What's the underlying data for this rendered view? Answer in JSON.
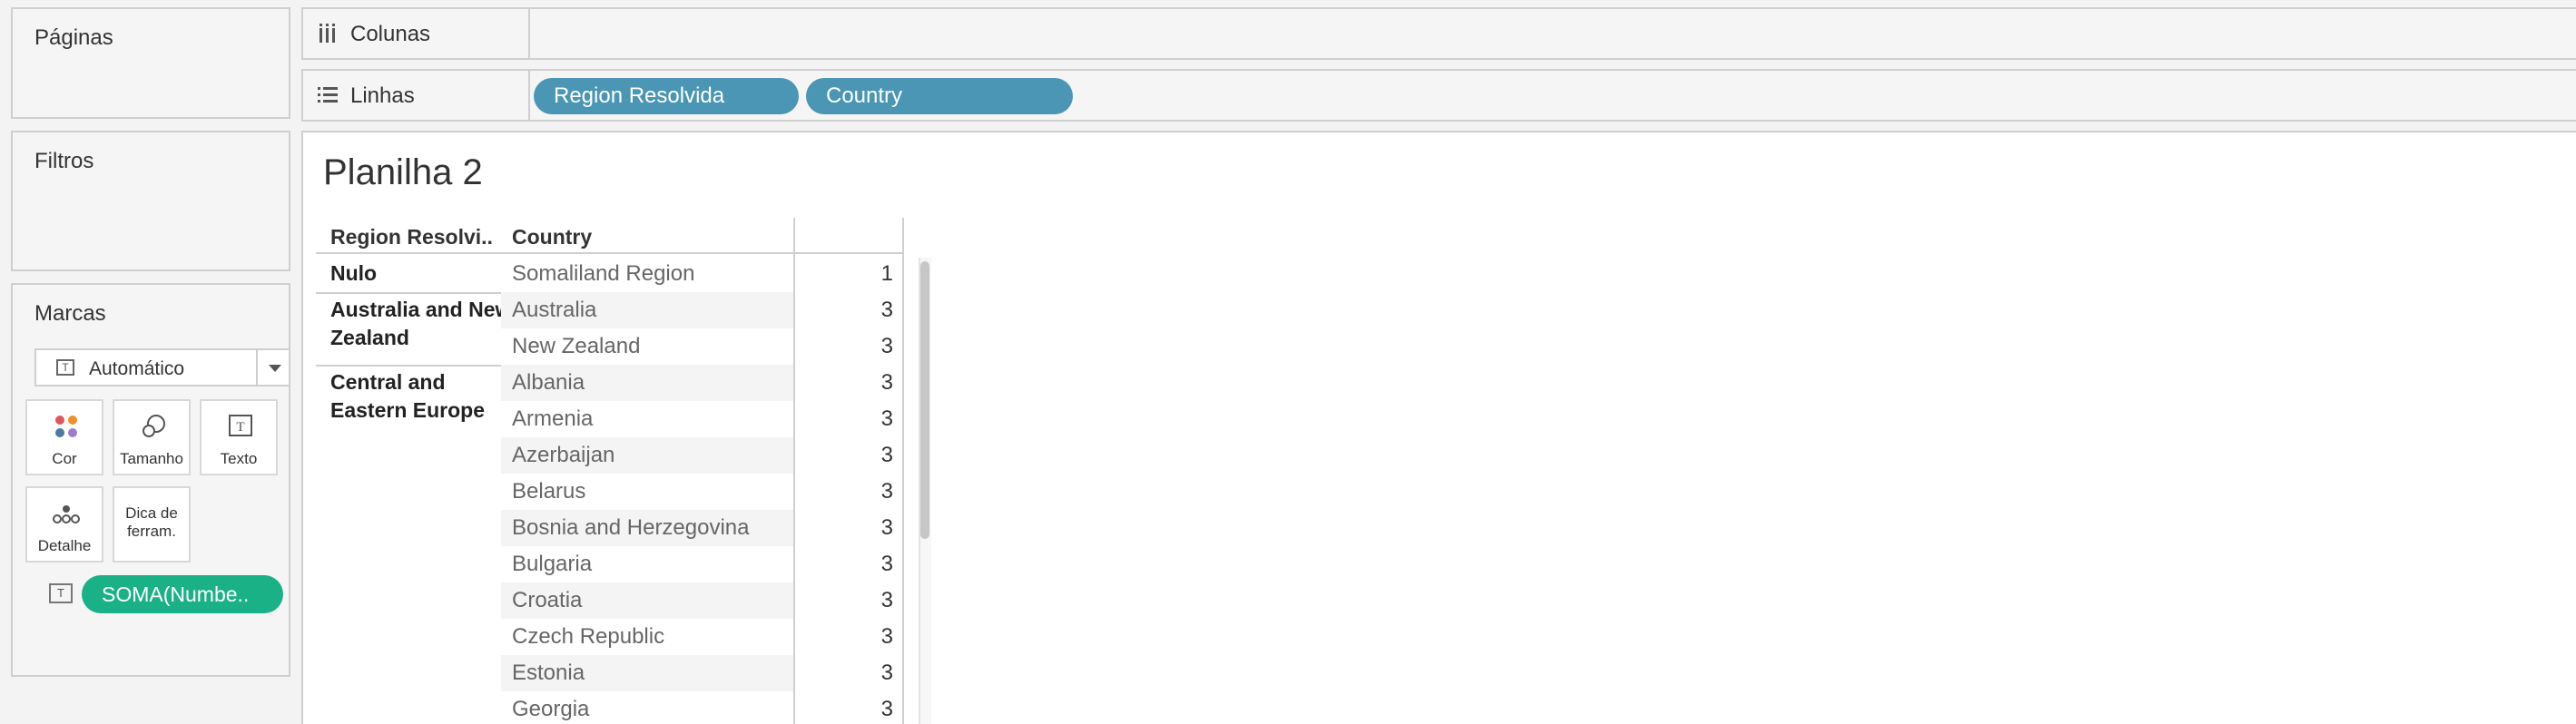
{
  "left_panels": {
    "pages_title": "Páginas",
    "filters_title": "Filtros",
    "marks_title": "Marcas"
  },
  "marks": {
    "type_label": "Automático",
    "buttons": {
      "color": "Cor",
      "size": "Tamanho",
      "text": "Texto",
      "detail": "Detalhe",
      "tooltip": "Dica de ferram."
    },
    "text_pill": "SOMA(Numbe.."
  },
  "shelves": {
    "columns_label": "Colunas",
    "rows_label": "Linhas",
    "row_pills": [
      "Region Resolvida",
      "Country"
    ]
  },
  "sheet": {
    "title": "Planilha 2",
    "headers": {
      "region": "Region Resolvi..",
      "country": "Country"
    },
    "regions": [
      "Nulo",
      "Australia and New Zealand",
      "Central and Eastern Europe"
    ],
    "rows": [
      {
        "country": "Somaliland Region",
        "value": "1"
      },
      {
        "country": "Australia",
        "value": "3"
      },
      {
        "country": "New Zealand",
        "value": "3"
      },
      {
        "country": "Albania",
        "value": "3"
      },
      {
        "country": "Armenia",
        "value": "3"
      },
      {
        "country": "Azerbaijan",
        "value": "3"
      },
      {
        "country": "Belarus",
        "value": "3"
      },
      {
        "country": "Bosnia and Herzegovina",
        "value": "3"
      },
      {
        "country": "Bulgaria",
        "value": "3"
      },
      {
        "country": "Croatia",
        "value": "3"
      },
      {
        "country": "Czech Republic",
        "value": "3"
      },
      {
        "country": "Estonia",
        "value": "3"
      },
      {
        "country": "Georgia",
        "value": "3"
      }
    ]
  },
  "colors": {
    "row_pill": "#4a96b4",
    "measure_pill": "#1ab187"
  }
}
